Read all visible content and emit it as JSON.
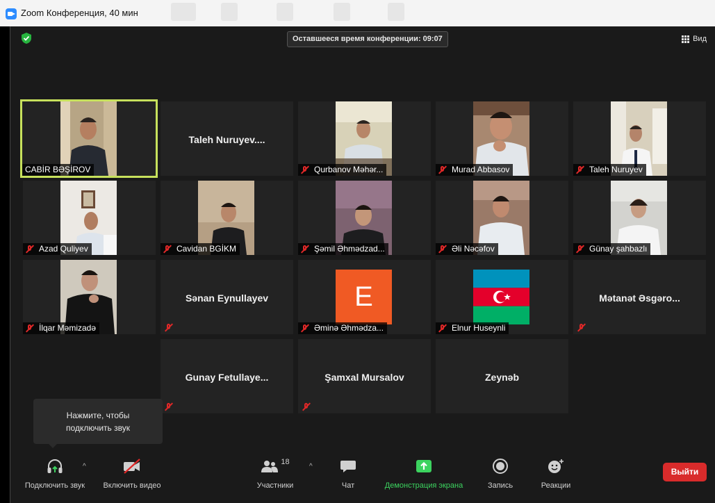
{
  "window": {
    "title": "Zoom Конференция, 40 мин"
  },
  "header": {
    "timer": "Оставшееся время конференции: 09:07",
    "view_label": "Вид"
  },
  "tiles": [
    {
      "name": "CABİR BƏŞİROV",
      "muted": false,
      "active": true,
      "kind": "video"
    },
    {
      "name": "Taleh  Nuruyev....",
      "kind": "name"
    },
    {
      "name": "Qurbanov Məhər...",
      "muted": true,
      "kind": "video"
    },
    {
      "name": "Murad Abbasov",
      "muted": true,
      "kind": "video"
    },
    {
      "name": "Taleh Nuruyev",
      "muted": true,
      "kind": "video"
    },
    {
      "name": "Azad Quliyev",
      "muted": true,
      "kind": "video"
    },
    {
      "name": "Cavidan BGİKM",
      "muted": true,
      "kind": "video"
    },
    {
      "name": "Şəmil Əhmədzad...",
      "muted": true,
      "kind": "video"
    },
    {
      "name": "Əli Nəcəfov",
      "muted": true,
      "kind": "video"
    },
    {
      "name": "Günay şahbazlı",
      "muted": true,
      "kind": "video"
    },
    {
      "name": "İlqar Məmizadə",
      "muted": true,
      "kind": "video"
    },
    {
      "name": "Sənan Eynullayev",
      "kind": "name"
    },
    {
      "name": "Əminə Əhmədza...",
      "muted": true,
      "kind": "avatar",
      "letter": "E"
    },
    {
      "name": "Elnur Huseynli",
      "muted": true,
      "kind": "flag"
    },
    {
      "name": "Mətanət  Əsgəro...",
      "kind": "name"
    },
    {
      "name": "Gunay  Fetullaye...",
      "kind": "name"
    },
    {
      "name": "Şamxal Mursalov",
      "kind": "name"
    },
    {
      "name": "Zeynəb",
      "kind": "name"
    }
  ],
  "tooltip": {
    "line1": "Нажмите, чтобы",
    "line2": "подключить звук"
  },
  "toolbar": {
    "audio_label": "Подключить звук",
    "video_label": "Включить видео",
    "participants_label": "Участники",
    "participants_count": "18",
    "chat_label": "Чат",
    "share_label": "Демонстрация экрана",
    "record_label": "Запись",
    "reactions_label": "Реакции",
    "exit_label": "Выйти"
  },
  "colors": {
    "active_speaker_border": "#c7e15c",
    "share_green": "#3cd35f",
    "exit_red": "#d92b2b",
    "muted_red": "#e02828",
    "avatar_orange": "#f05a24"
  }
}
